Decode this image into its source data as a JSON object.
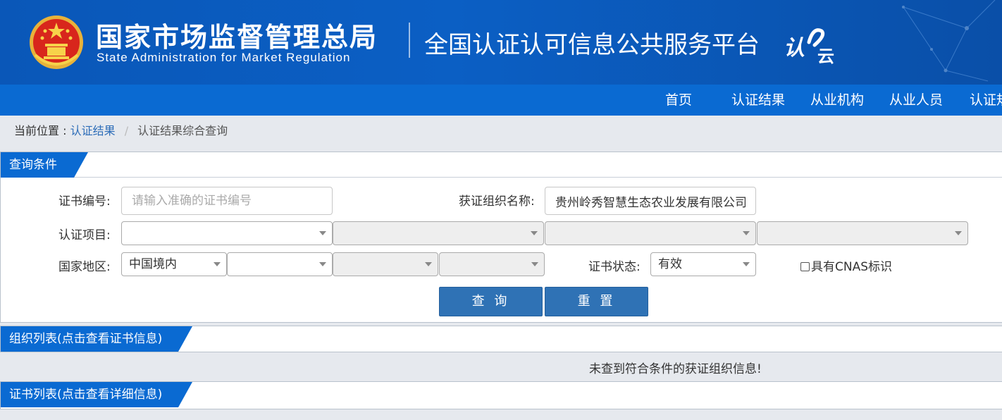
{
  "header": {
    "agency_cn": "国家市场监督管理总局",
    "agency_en": "State Administration  for  Market Regulation",
    "platform_title": "全国认证认可信息公共服务平台",
    "cloud_logo_text": "认云"
  },
  "nav": {
    "items": [
      {
        "label": "首页"
      },
      {
        "label": "认证结果"
      },
      {
        "label": "从业机构"
      },
      {
        "label": "从业人员"
      },
      {
        "label": "认证规"
      }
    ]
  },
  "breadcrumb": {
    "prefix": "当前位置 :",
    "link": "认证结果",
    "separator": "/",
    "current": "认证结果综合查询"
  },
  "query_panel": {
    "title": "查询条件",
    "cert_no_label": "证书编号:",
    "cert_no_placeholder": "请输入准确的证书编号",
    "org_name_label": "获证组织名称:",
    "org_name_value": "贵州岭秀智慧生态农业发展有限公司",
    "cert_item_label": "认证项目:",
    "region_label": "国家地区:",
    "region_value": "中国境内",
    "status_label": "证书状态:",
    "status_value": "有效",
    "cnas_label": "具有CNAS标识",
    "query_button": "查 询",
    "reset_button": "重 置"
  },
  "org_list_panel": {
    "title": "组织列表(点击查看证书信息)",
    "empty_message": "未查到符合条件的获证组织信息!"
  },
  "cert_list_panel": {
    "title": "证书列表(点击查看详细信息)"
  },
  "colors": {
    "banner": "#0b5fc4",
    "navbar": "#0a6ad2",
    "tab": "#0a6ad2",
    "button": "#2f72b5",
    "link": "#2d6db8"
  }
}
